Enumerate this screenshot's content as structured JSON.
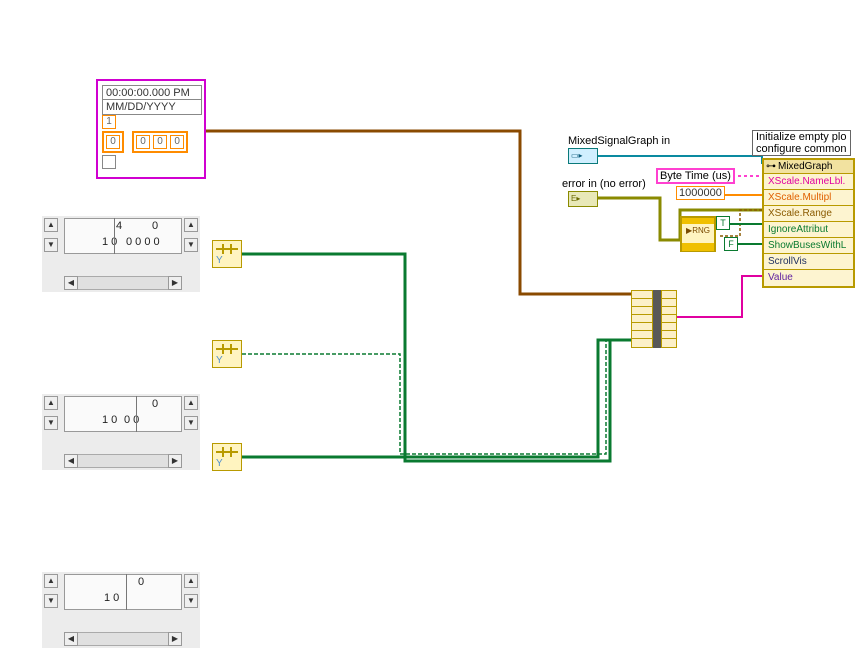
{
  "waveform_constant": {
    "time_line1": "00:00:00.000 PM",
    "time_line2": "MM/DD/YYYY",
    "count": "1",
    "index": "0",
    "cells": [
      "0",
      "0",
      "0"
    ]
  },
  "arrays": [
    {
      "header_left": "4",
      "header_right": "0",
      "row_left": "1 0",
      "row_values": "0 0 0 0"
    },
    {
      "header_left": "",
      "header_right": "0",
      "row_left": "1 0",
      "row_values": "0 0"
    },
    {
      "header_left": "",
      "header_right": "0",
      "row_left": "1 0",
      "row_values": ""
    }
  ],
  "controls": {
    "graph_ref_label": "MixedSignalGraph in",
    "error_in_label": "error in (no error)",
    "byte_time_label": "Byte Time (us)",
    "multiplier_value": "1000000",
    "true_const": "T",
    "false_const": "F",
    "subvi_label": "RNG"
  },
  "caption": {
    "line1": "Initialize empty plo",
    "line2": "configure common"
  },
  "property_node": {
    "header": "MixedGraph",
    "rows": [
      {
        "text": "XScale.NameLbl.",
        "cls": "pr-magenta"
      },
      {
        "text": "XScale.Multipl",
        "cls": "pr-orange"
      },
      {
        "text": "XScale.Range",
        "cls": "pr-brown"
      },
      {
        "text": "IgnoreAttribut",
        "cls": "pr-green"
      },
      {
        "text": "ShowBusesWithL",
        "cls": "pr-green"
      },
      {
        "text": "ScrollVis",
        "cls": "pr-navy"
      },
      {
        "text": "Value",
        "cls": "pr-purple"
      }
    ]
  }
}
